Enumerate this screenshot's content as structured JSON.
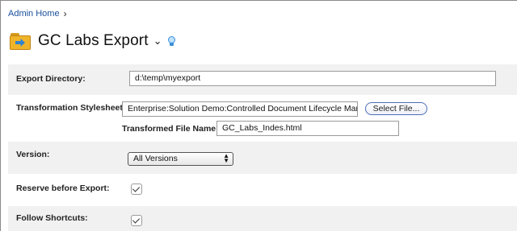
{
  "breadcrumb": {
    "label": "Admin Home",
    "separator": "›"
  },
  "header": {
    "title": "GC Labs Export",
    "dropdown_chevron": "⌄",
    "folder_icon": "folder-export-icon",
    "tip_icon": "lightbulb-icon"
  },
  "form": {
    "export_directory": {
      "label": "Export Directory:",
      "value": "d:\\temp\\myexport"
    },
    "transformation_stylesheet": {
      "label": "Transformation Stylesheet:",
      "value": "Enterprise:Solution Demo:Controlled Document Lifecycle Manage",
      "select_button": "Select File..."
    },
    "transformed_file_name": {
      "label": "Transformed File Name:",
      "value": "GC_Labs_Indes.html"
    },
    "version": {
      "label": "Version:",
      "selected": "All Versions"
    },
    "reserve_before_export": {
      "label": "Reserve before Export:",
      "checked": true
    },
    "follow_shortcuts": {
      "label": "Follow Shortcuts:",
      "checked": true
    }
  },
  "colors": {
    "link": "#1a4f9c",
    "band": "#f1f1f1",
    "button_border": "#4d6db8",
    "folder": "#f0b42a",
    "accent_blue": "#2f83cf"
  }
}
